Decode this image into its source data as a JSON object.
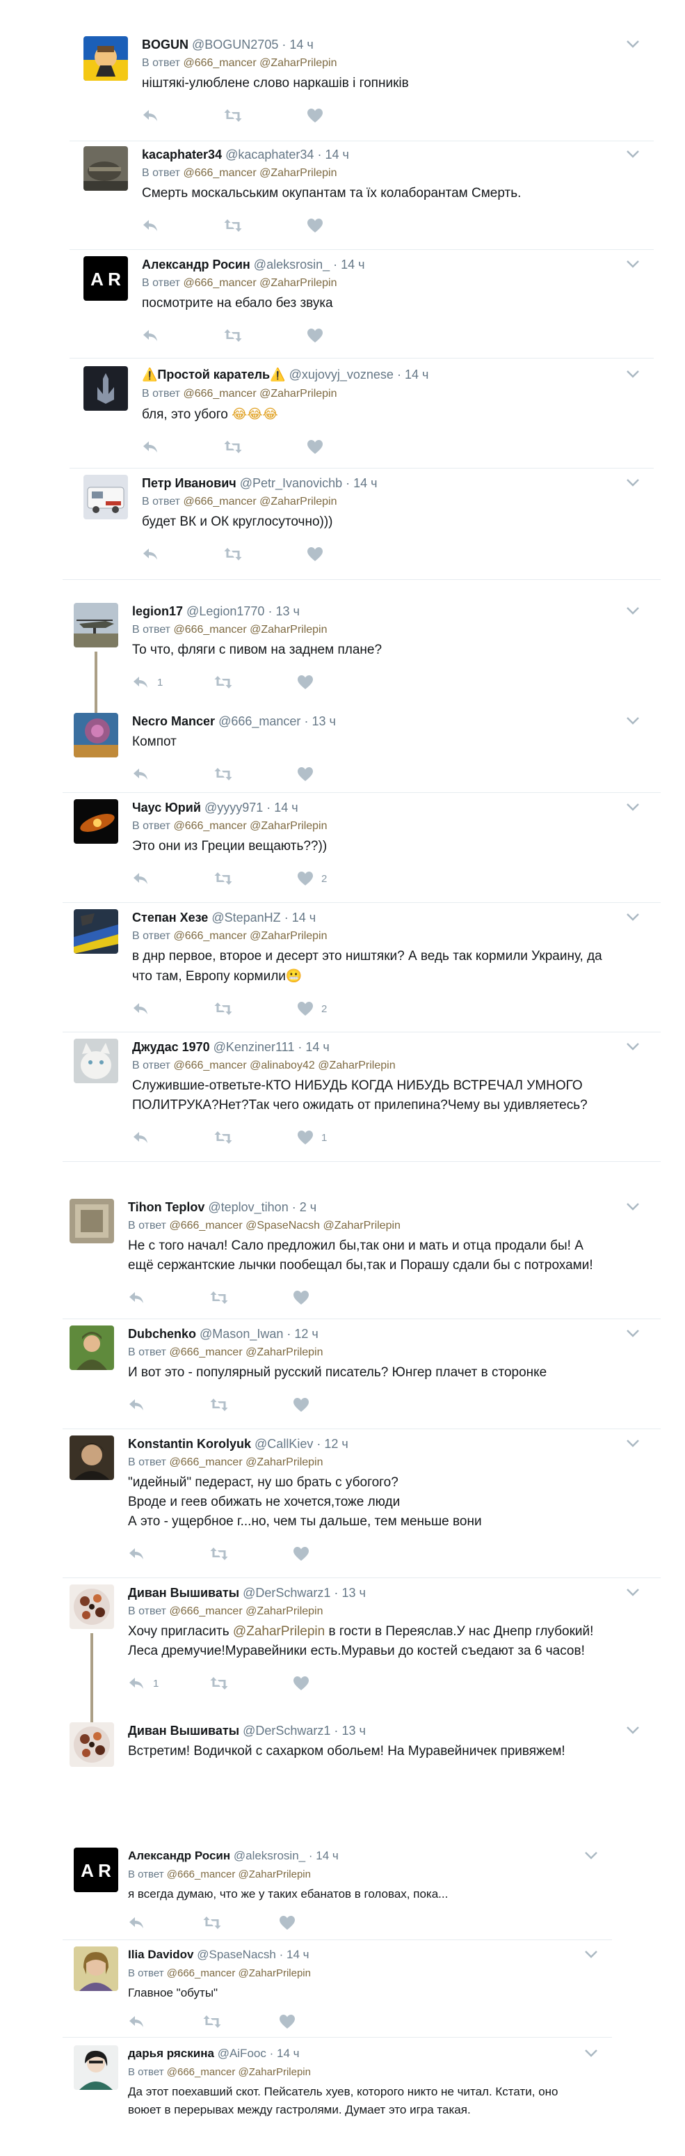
{
  "colors": {
    "link": "#7e6a42",
    "muted": "#657786",
    "action": "#b2bfc9",
    "divider": "#e6ecf0",
    "thread": "#ab9f86"
  },
  "tweets": [
    {
      "name": "BOGUN",
      "handle": "@BOGUN2705",
      "time": "14 ч",
      "reply_label": "В ответ",
      "mentions": [
        "@666_mancer",
        "@ZaharPrilepin"
      ],
      "text": "ніштякі-улюблене слово наркашів і гопників",
      "reply_count": "",
      "like_count": ""
    },
    {
      "name": "kacaphater34",
      "handle": "@kacaphater34",
      "time": "14 ч",
      "reply_label": "В ответ",
      "mentions": [
        "@666_mancer",
        "@ZaharPrilepin"
      ],
      "text": "Смерть москальським окупантам та їх колаборантам Смерть.",
      "reply_count": "",
      "like_count": ""
    },
    {
      "name": "Александр Росин",
      "handle": "@aleksrosin_",
      "time": "14 ч",
      "reply_label": "В ответ",
      "mentions": [
        "@666_mancer",
        "@ZaharPrilepin"
      ],
      "text": "посмотрите на ебало без звука",
      "reply_count": "",
      "like_count": ""
    },
    {
      "name": "Простой каратель",
      "name_emoji_left": "⚠️",
      "name_emoji_right": "⚠️",
      "handle": "@xujovyj_voznese",
      "time": "14 ч",
      "reply_label": "В ответ",
      "mentions": [
        "@666_mancer",
        "@ZaharPrilepin"
      ],
      "text": "бля, это убого",
      "text_emoji": "😂😂😂",
      "reply_count": "",
      "like_count": ""
    },
    {
      "name": "Петр Иванович",
      "handle": "@Petr_Ivanovichb",
      "time": "14 ч",
      "reply_label": "В ответ",
      "mentions": [
        "@666_mancer",
        "@ZaharPrilepin"
      ],
      "text": "будет ВК и ОК круглосуточно)))",
      "reply_count": "",
      "like_count": ""
    },
    {
      "name": "legion17",
      "handle": "@Legion1770",
      "time": "13 ч",
      "reply_label": "В ответ",
      "mentions": [
        "@666_mancer",
        "@ZaharPrilepin"
      ],
      "text": "То что, фляги с пивом на заднем плане?",
      "reply_count": "1",
      "like_count": ""
    },
    {
      "name": "Necro Mancer",
      "handle": "@666_mancer",
      "time": "13 ч",
      "text": "Компот",
      "reply_count": "",
      "like_count": ""
    },
    {
      "name": "Чаус Юрий",
      "handle": "@yyyy971",
      "time": "14 ч",
      "reply_label": "В ответ",
      "mentions": [
        "@666_mancer",
        "@ZaharPrilepin"
      ],
      "text": "Это они из Греции вещають??))",
      "reply_count": "",
      "like_count": "2"
    },
    {
      "name": "Степан Хезе",
      "handle": "@StepanHZ",
      "time": "14 ч",
      "reply_label": "В ответ",
      "mentions": [
        "@666_mancer",
        "@ZaharPrilepin"
      ],
      "text": "в днр первое, второе и десерт это ништяки? А ведь так кормили Украину, да что там, Европу кормили",
      "text_emoji": "😬",
      "reply_count": "",
      "like_count": "2"
    },
    {
      "name": "Джудас 1970",
      "handle": "@Kenziner111",
      "time": "14 ч",
      "reply_label": "В ответ",
      "mentions": [
        "@666_mancer",
        "@alinaboy42",
        "@ZaharPrilepin"
      ],
      "text": "Служившие-ответьте-КТО НИБУДЬ КОГДА НИБУДЬ ВСТРЕЧАЛ УМНОГО ПОЛИТРУКА?Нет?Так чего ожидать от прилепина?Чему вы удивляетесь?",
      "reply_count": "",
      "like_count": "1"
    },
    {
      "name": "Tihon Teplov",
      "handle": "@teplov_tihon",
      "time": "2 ч",
      "reply_label": "В ответ",
      "mentions": [
        "@666_mancer",
        "@SpaseNacsh",
        "@ZaharPrilepin"
      ],
      "text": "Не с того начал! Сало предложил бы,так они и мать и отца продали бы! А ещё сержантские лычки пообещал бы,так и Порашу сдали бы с потрохами!",
      "reply_count": "",
      "like_count": ""
    },
    {
      "name": "Dubchenko",
      "handle": "@Mason_Iwan",
      "time": "12 ч",
      "reply_label": "В ответ",
      "mentions": [
        "@666_mancer",
        "@ZaharPrilepin"
      ],
      "text": "И вот это - популярный русский писатель? Юнгер плачет в сторонке",
      "reply_count": "",
      "like_count": ""
    },
    {
      "name": "Konstantin Korolyuk",
      "handle": "@CallKiev",
      "time": "12 ч",
      "reply_label": "В ответ",
      "mentions": [
        "@666_mancer",
        "@ZaharPrilepin"
      ],
      "text": "\"идейный\" педераст, ну шо брать с убогого?\nВроде и геев обижать не хочется,тоже люди\nА это - ущербное г...но, чем ты дальше, тем меньше вони",
      "reply_count": "",
      "like_count": ""
    },
    {
      "name": "Диван Вышиваты",
      "handle": "@DerSchwarz1",
      "time": "13 ч",
      "reply_label": "В ответ",
      "mentions": [
        "@666_mancer",
        "@ZaharPrilepin"
      ],
      "text_prefix": "Хочу пригласить ",
      "text_mention": "@ZaharPrilepin",
      "text": " в гости в Переяслав.У нас Днепр глубокий! Леса дремучие!Муравейники есть.Муравьи до костей съедают за 6 часов!",
      "reply_count": "1",
      "like_count": ""
    },
    {
      "name": "Диван Вышиваты",
      "handle": "@DerSchwarz1",
      "time": "13 ч",
      "text": "Встретим! Водичкой с сахарком обольем! На Муравейничек привяжем!"
    },
    {
      "name": "Александр Росин",
      "handle": "@aleksrosin_",
      "time": "14 ч",
      "reply_label": "В ответ",
      "mentions": [
        "@666_mancer",
        "@ZaharPrilepin"
      ],
      "text": "я всегда думаю, что же у таких ебанатов в головах, пока...",
      "reply_count": "",
      "like_count": ""
    },
    {
      "name": "Ilia Davidov",
      "handle": "@SpaseNacsh",
      "time": "14 ч",
      "reply_label": "В ответ",
      "mentions": [
        "@666_mancer",
        "@ZaharPrilepin"
      ],
      "text": "Главное \"обуты\"",
      "reply_count": "",
      "like_count": ""
    },
    {
      "name": "дарья ряскина",
      "handle": "@AiFooc",
      "time": "14 ч",
      "reply_label": "В ответ",
      "mentions": [
        "@666_mancer",
        "@ZaharPrilepin"
      ],
      "text": "Да этот поехавший скот. Пейсатель хуев, которого никто не читал. Кстати, оно воюет в перерывах между гастролями. Думает это игра такая."
    }
  ],
  "avatar_letters": {
    "ar": "A R"
  }
}
